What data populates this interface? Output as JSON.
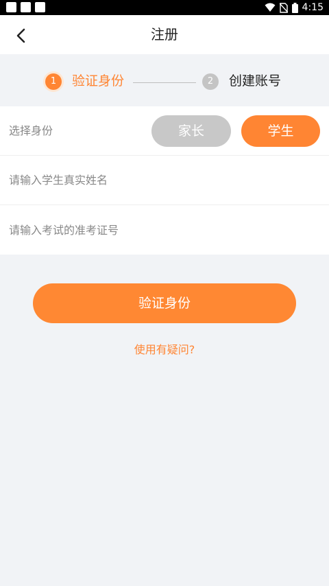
{
  "status_bar": {
    "time": "4:15",
    "icons": [
      "wifi-icon",
      "no-sim-icon",
      "battery-icon"
    ]
  },
  "header": {
    "title": "注册",
    "back_icon": "chevron-left-icon"
  },
  "steps": [
    {
      "number": "1",
      "label": "验证身份",
      "active": true
    },
    {
      "number": "2",
      "label": "创建账号",
      "active": false
    }
  ],
  "form": {
    "identity_label": "选择身份",
    "identity_options": [
      "家长",
      "学生"
    ],
    "identity_selected": "学生",
    "name_placeholder": "请输入学生真实姓名",
    "exam_id_placeholder": "请输入考试的准考证号"
  },
  "actions": {
    "verify_label": "验证身份",
    "help_link": "使用有疑问?"
  },
  "colors": {
    "accent": "#ff8533",
    "inactive": "#c8c8c8",
    "background": "#f1f3f6"
  }
}
